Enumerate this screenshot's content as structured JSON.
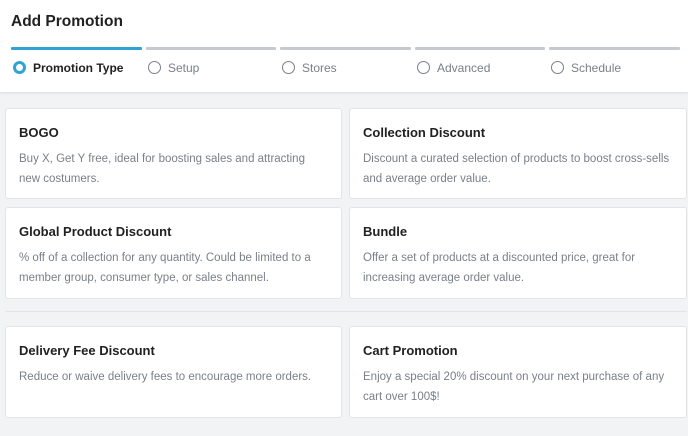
{
  "header": {
    "title": "Add Promotion"
  },
  "steps": [
    {
      "label": "Promotion Type",
      "active": true
    },
    {
      "label": "Setup",
      "active": false
    },
    {
      "label": "Stores",
      "active": false
    },
    {
      "label": "Advanced",
      "active": false
    },
    {
      "label": "Schedule",
      "active": false
    }
  ],
  "colors": {
    "accent": "#2ea3d4",
    "inactive_bar": "#c5c9d0",
    "muted_text": "#7a7f88"
  },
  "cards": [
    {
      "title": "BOGO",
      "description": "Buy X, Get Y free, ideal for boosting sales and attracting new costumers."
    },
    {
      "title": "Collection Discount",
      "description": "Discount a curated selection of products to boost cross-sells and average order value."
    },
    {
      "title": "Global Product Discount",
      "description": "% off of a collection for any quantity. Could be limited to a member group, consumer type, or sales channel."
    },
    {
      "title": "Bundle",
      "description": "Offer a set of products at a discounted price, great for increasing average order value."
    },
    {
      "title": "Delivery Fee Discount",
      "description": "Reduce or waive delivery fees to encourage more orders."
    },
    {
      "title": "Cart Promotion",
      "description": "Enjoy a special 20% discount on your next purchase of any cart over 100$!"
    }
  ]
}
